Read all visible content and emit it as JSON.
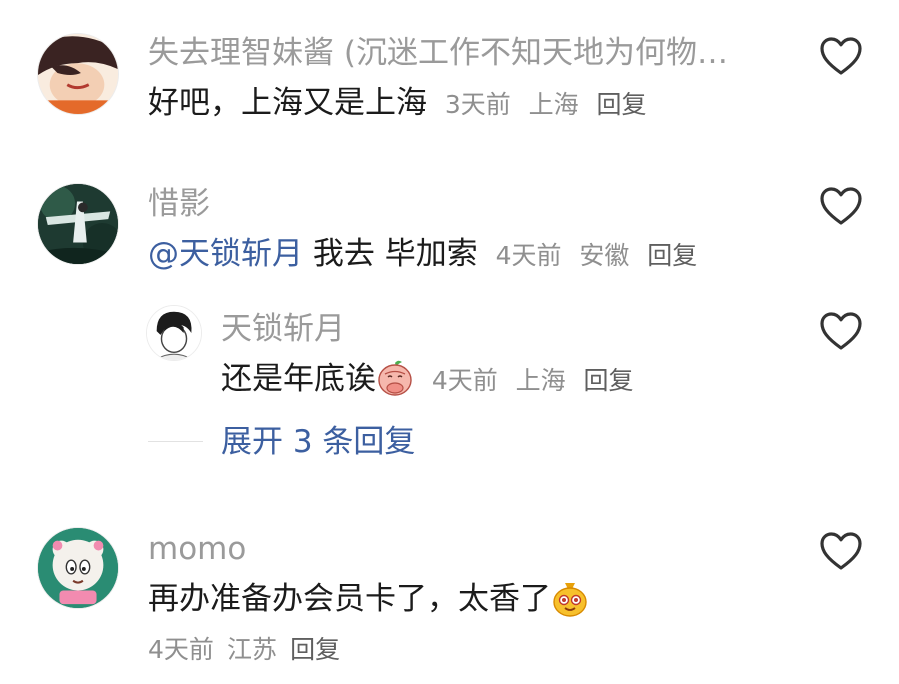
{
  "comments": [
    {
      "username": "失去理智妹酱 (沉迷工作不知天地为何物…",
      "text": "好吧，上海又是上海",
      "time": "3天前",
      "location": "上海",
      "reply_label": "回复"
    },
    {
      "username": "惜影",
      "mention": "@天锁斩月",
      "text": " 我去 毕加索",
      "time": "4天前",
      "location": "安徽",
      "reply_label": "回复",
      "sub_reply": {
        "username": "天锁斩月",
        "text": "还是年底诶",
        "time": "4天前",
        "location": "上海",
        "reply_label": "回复"
      },
      "expand_label": "展开 3 条回复"
    },
    {
      "username": "momo",
      "text": "再办准备办会员卡了，太香了",
      "time": "4天前",
      "location": "江苏",
      "reply_label": "回复"
    }
  ],
  "icons": {
    "like": "heart-outline-icon",
    "emoji_blessing": "peach-bow-emoji",
    "emoji_lucky": "lucky-bag-emoji"
  },
  "colors": {
    "mention": "#3c5fa0",
    "username": "#9a9a9a",
    "meta": "#8f8f8f"
  }
}
